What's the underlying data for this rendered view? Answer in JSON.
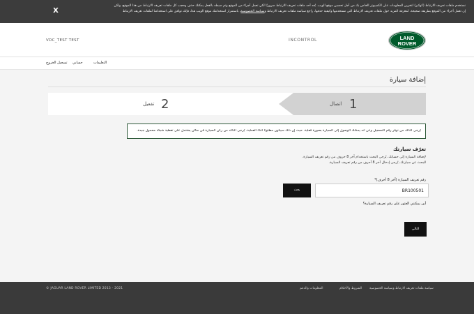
{
  "cookie_banner": {
    "line1": "نستخدم ملفات تعريف الارتباط (كوكيز) لتخزين المعلومات على الكمبيوتر الخاص بك من أجل تحسين موقع الويب. يُعد أحد ملفات تعريف الارتباط ضروريًا لكي تعمل أجزاء من الموقع وتم ضبطه بالفعل يمكنك حذف وحجب كل ملفات تعريف الارتباط من هذا الموقع، ولكن",
    "line2": "إن تعمل أجزاء من الموقع بطريقة صحيحة. لمعرفة المزيد حول ملفات تعريف الارتباط التي نستخدمها وكيفية حذفها، راجع سياسة ملفات تعريف الارتباط و",
    "link": "سياسة الخصوصية",
    "line2_end": "، باستمرار استخدامك موقع الويب هذا، فإنك توافق على استخدامنا لملفات تعريف الارتباط",
    "close_label": "X"
  },
  "header": {
    "user_id": "VDC_TEST TEST",
    "brand_name": "INCONTROL",
    "logo_line1": "LAND",
    "logo_line2": "ROVER",
    "logo_color": "#005a2b"
  },
  "nav": {
    "items": [
      "التعليمات",
      "حسابي",
      "تسجيل الخروج"
    ]
  },
  "main": {
    "title": "إضافة سيارة",
    "steps": [
      {
        "number": "1",
        "label": "اتصال",
        "active": true
      },
      {
        "number": "2",
        "label": "تفعيل",
        "active": false
      }
    ],
    "notice": "يُرجى التأكد من توفر رقم التسجيل وعن أنه يمكنك الوصول إلى السيارة بصورة فعلية. حيث إن ذلك سيكون مطلوبًا أثناء العملية. يُرجى التأكد من ركن السيارة في مكان يشتمل على تغطية شبكة محمول جيدة.",
    "section_title": "تعرّف سيارتك",
    "desc": [
      "لإضافة السيارة إلى حسابك، يُرجى البحث باستخدام آخر 8 حروف من رقم تعريف السيارة.",
      "للبحث عن سيارتك، يُرجى إدخال آخر 8 أحرف من رقم تعريف السيارة."
    ],
    "field_label": "رقم تعريف السيارة (آخر 8 أحرف)*",
    "vin_value": "BR100501",
    "search_label": "بحث",
    "help_link": "أين يمكنني العثور على رقم تعريف السيارة؟",
    "next_label": "التالي"
  },
  "footer": {
    "copyright": "© JAGUAR LAND ROVER LIMITED 2013 - 2021",
    "links": [
      "سياسة ملفات تعريف الارتباط وسياسة الخصوصية",
      "الشروط والأحكام",
      "المعلومات والدعم"
    ]
  }
}
